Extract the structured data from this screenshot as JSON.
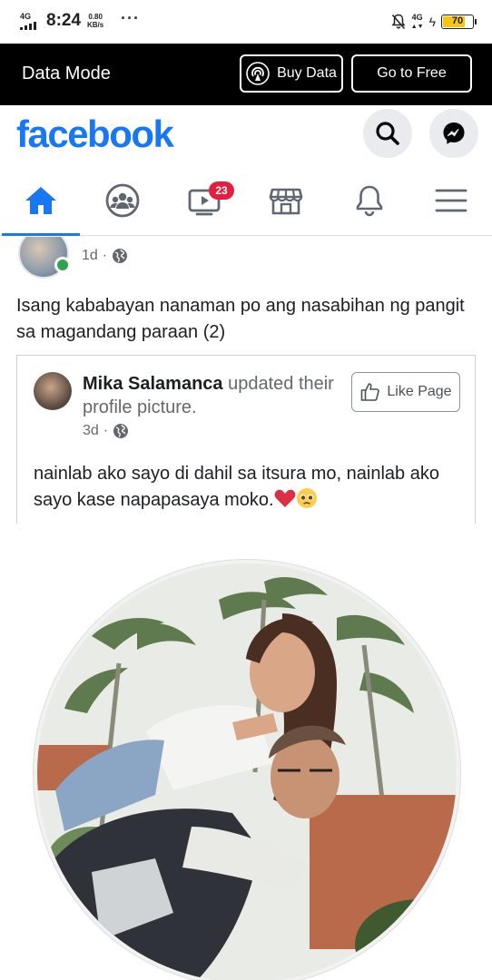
{
  "status_bar": {
    "network_left": "4G",
    "time": "8:24",
    "speed_value": "0.80",
    "speed_unit": "KB/s",
    "more": "···",
    "network_right": "4G",
    "battery": "70",
    "battery_color": "#f5c518"
  },
  "data_mode": {
    "title": "Data Mode",
    "buy_label": "Buy Data",
    "free_label": "Go to Free"
  },
  "header": {
    "logo": "facebook",
    "brand_color": "#1877f2"
  },
  "nav": {
    "tabs": [
      {
        "icon": "home-icon",
        "active": true
      },
      {
        "icon": "groups-icon",
        "active": false
      },
      {
        "icon": "watch-icon",
        "active": false,
        "badge": "23"
      },
      {
        "icon": "marketplace-icon",
        "active": false
      },
      {
        "icon": "notifications-icon",
        "active": false
      },
      {
        "icon": "menu-icon",
        "active": false
      }
    ]
  },
  "post": {
    "time": "1d",
    "separator": "·",
    "text": "Isang kababayan nanaman po ang nasabihan ng pangit sa magandang paraan (2)",
    "shared": {
      "author": "Mika Salamanca",
      "action": " updated their profile picture.",
      "time": "3d",
      "separator": "·",
      "like_page_label": "Like Page",
      "text": "nainlab ako sayo di dahil sa itsura mo, nainlab ako sayo kase napapasaya moko."
    }
  }
}
